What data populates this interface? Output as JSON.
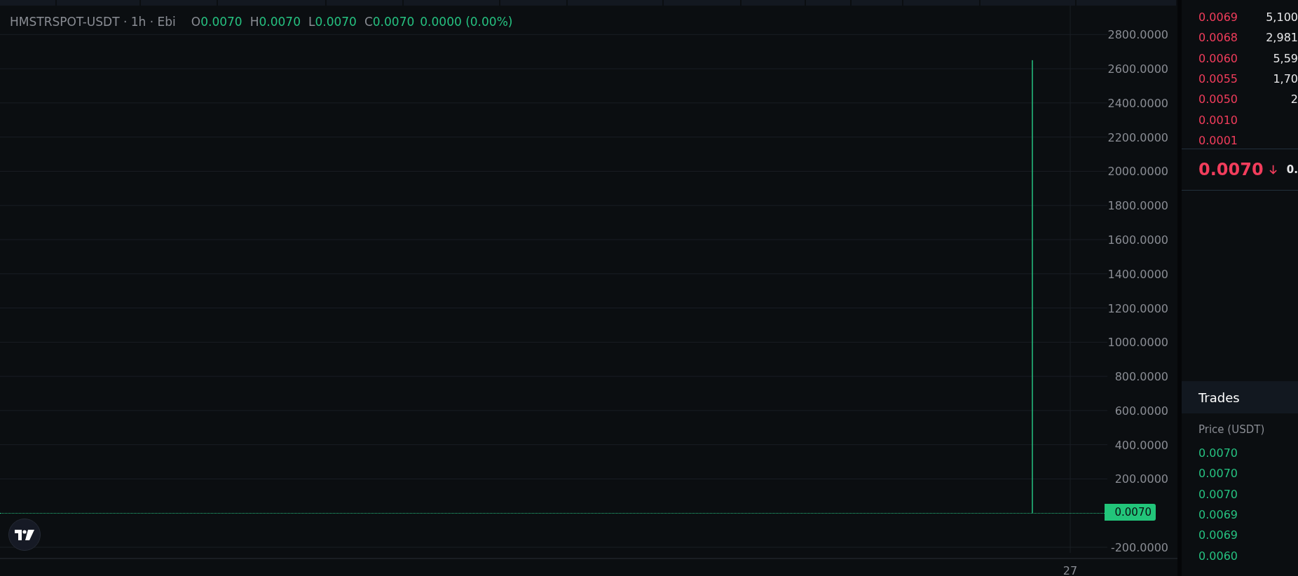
{
  "chart": {
    "legend": {
      "symbol": "HMSTRSPOT-USDT · 1h · Ebi",
      "ohlc": [
        {
          "label": "O",
          "value": "0.0070"
        },
        {
          "label": "H",
          "value": "0.0070"
        },
        {
          "label": "L",
          "value": "0.0070"
        },
        {
          "label": "C",
          "value": "0.0070"
        }
      ],
      "change": "0.0000 (0.00%)"
    },
    "last_price_label": "0.0070",
    "chart_data": {
      "type": "bar",
      "grid": true,
      "ylim": [
        -200,
        2800
      ],
      "yticks": [
        {
          "value": 2800,
          "label": "2800.0000"
        },
        {
          "value": 2600,
          "label": "2600.0000"
        },
        {
          "value": 2400,
          "label": "2400.0000"
        },
        {
          "value": 2200,
          "label": "2200.0000"
        },
        {
          "value": 2000,
          "label": "2000.0000"
        },
        {
          "value": 1800,
          "label": "1800.0000"
        },
        {
          "value": 1600,
          "label": "1600.0000"
        },
        {
          "value": 1400,
          "label": "1400.0000"
        },
        {
          "value": 1200,
          "label": "1200.0000"
        },
        {
          "value": 1000,
          "label": "1000.0000"
        },
        {
          "value": 800,
          "label": "800.0000"
        },
        {
          "value": 600,
          "label": "600.0000"
        },
        {
          "value": 400,
          "label": "400.0000"
        },
        {
          "value": 200,
          "label": "200.0000"
        },
        {
          "value": -200,
          "label": "-200.0000"
        }
      ],
      "series": [
        {
          "color": "#26c281",
          "values": [
            2650
          ]
        }
      ],
      "annotations": [
        {
          "text": "27"
        }
      ]
    }
  },
  "order_book": {
    "asks": [
      {
        "price": "0.0069",
        "amount": "5,100"
      },
      {
        "price": "0.0068",
        "amount": "2,981"
      },
      {
        "price": "0.0060",
        "amount": "5,59"
      },
      {
        "price": "0.0055",
        "amount": "1,70"
      },
      {
        "price": "0.0050",
        "amount": "2"
      },
      {
        "price": "0.0010"
      },
      {
        "price": "0.0001"
      }
    ],
    "last_price": {
      "value": "0.0070",
      "falling": true,
      "secondary": "0."
    }
  },
  "trades": {
    "title": "Trades",
    "column_1": "Price (USDT)",
    "rows": [
      {
        "price": "0.0070",
        "buy": true
      },
      {
        "price": "0.0070",
        "buy": true
      },
      {
        "price": "0.0070",
        "buy": true
      },
      {
        "price": "0.0069",
        "buy": true
      },
      {
        "price": "0.0069",
        "buy": true
      },
      {
        "price": "0.0060",
        "buy": true
      }
    ]
  }
}
